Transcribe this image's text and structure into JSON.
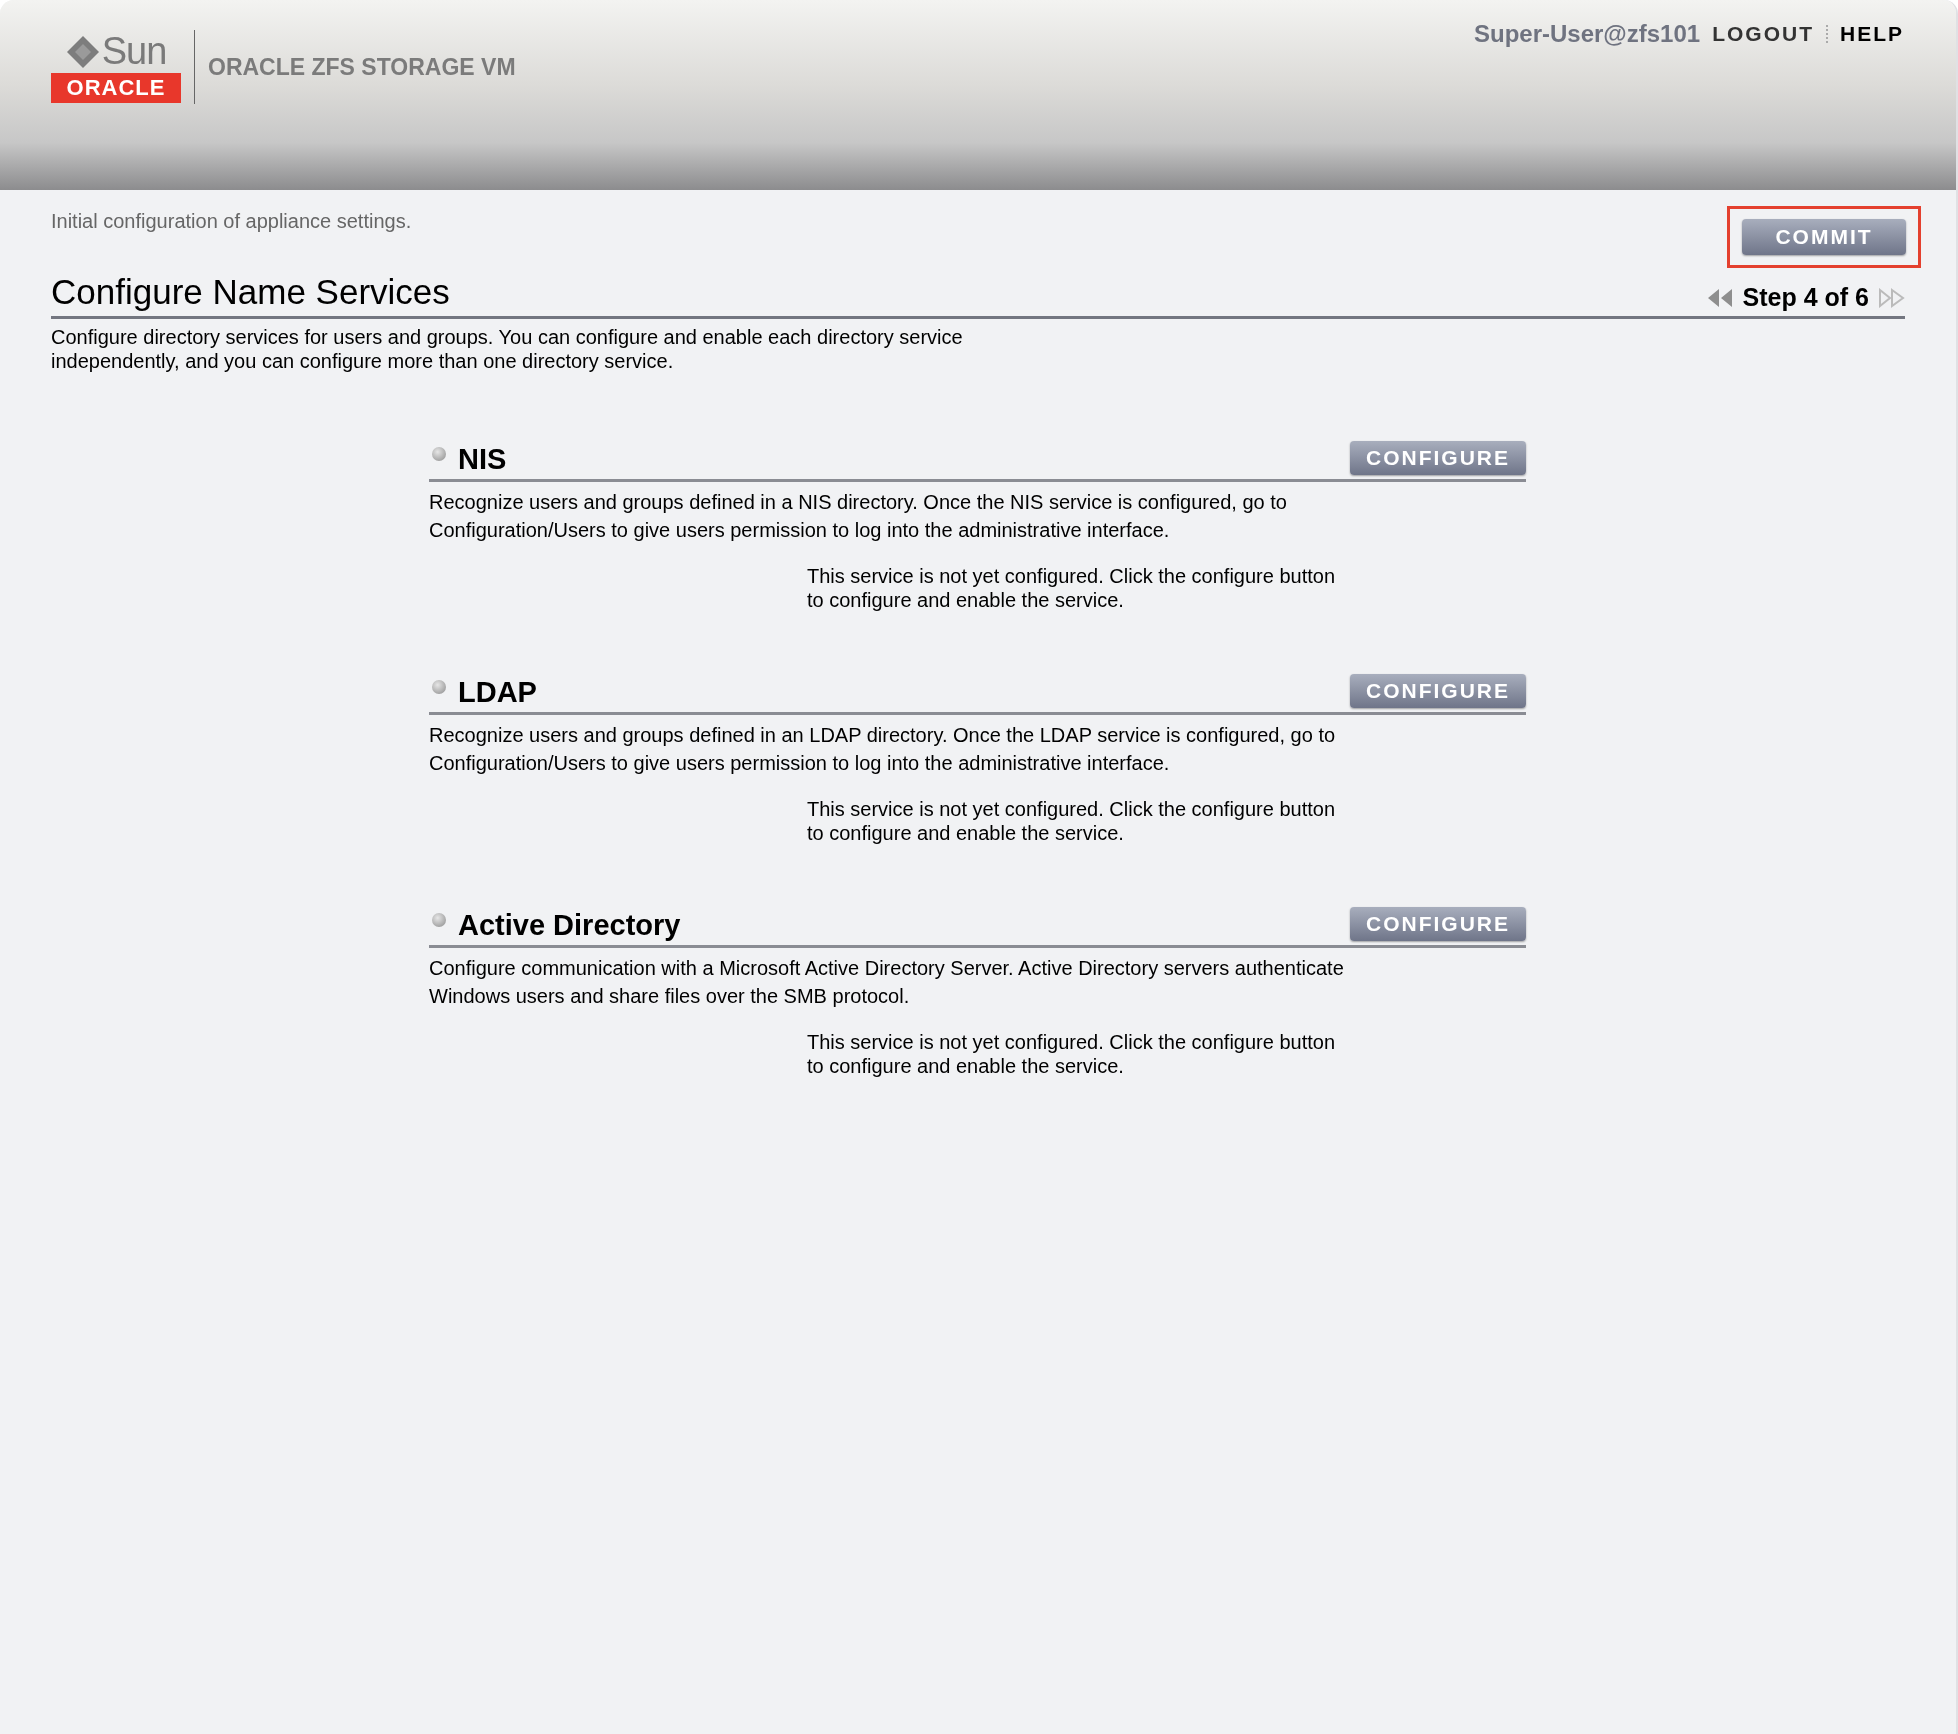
{
  "header": {
    "logo": {
      "sun": "Sun",
      "oracle": "ORACLE"
    },
    "product": "ORACLE ZFS STORAGE VM",
    "user": "Super-User@zfs101",
    "links": [
      "LOGOUT",
      "HELP"
    ]
  },
  "subtitle": "Initial configuration of appliance settings.",
  "commit": {
    "label": "COMMIT",
    "highlighted": true
  },
  "page": {
    "title": "Configure Name Services",
    "step": "Step 4 of 6",
    "description": "Configure directory services for users and groups. You can configure and enable each directory service independently, and you can configure more than one directory service."
  },
  "services": [
    {
      "name": "NIS",
      "configured": false,
      "button": "CONFIGURE",
      "description": "Recognize users and groups defined in a NIS directory. Once the NIS service is configured, go to Configuration/Users to give users permission to log into the administrative interface.",
      "status": "This service is not yet configured. Click the configure button to configure and enable the service."
    },
    {
      "name": "LDAP",
      "configured": false,
      "button": "CONFIGURE",
      "description": "Recognize users and groups defined in an LDAP directory. Once the LDAP service is configured, go to Configuration/Users to give users permission to log into the administrative interface.",
      "status": "This service is not yet configured. Click the configure button to configure and enable the service."
    },
    {
      "name": "Active Directory",
      "configured": false,
      "button": "CONFIGURE",
      "description": "Configure communication with a Microsoft Active Directory Server. Active Directory servers authenticate Windows users and share files over the SMB protocol.",
      "status": "This service is not yet configured. Click the configure button to configure and enable the service."
    }
  ]
}
